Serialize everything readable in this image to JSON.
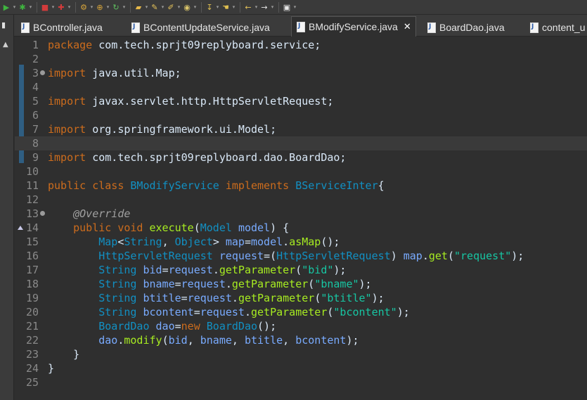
{
  "toolbar": {
    "icons": [
      {
        "name": "run-icon",
        "glyph": "▶",
        "color": "#3fb43f"
      },
      {
        "name": "debug-icon",
        "glyph": "✱",
        "color": "#3fb43f"
      },
      {
        "name": "stop-icon",
        "glyph": "■",
        "color": "#d23b3b"
      },
      {
        "name": "server-icon",
        "glyph": "✚",
        "color": "#d23b3b"
      },
      {
        "name": "new-wizard-icon",
        "glyph": "⚙",
        "color": "#d9a63a"
      },
      {
        "name": "new-package-icon",
        "glyph": "⊕",
        "color": "#d9a63a"
      },
      {
        "name": "refresh-icon",
        "glyph": "↻",
        "color": "#5fbf5f"
      },
      {
        "name": "open-folder-icon",
        "glyph": "▰",
        "color": "#e6b84a"
      },
      {
        "name": "open-type-icon",
        "glyph": "✎",
        "color": "#e6c35a"
      },
      {
        "name": "brush-icon",
        "glyph": "✐",
        "color": "#e6c35a"
      },
      {
        "name": "search-icon",
        "glyph": "◉",
        "color": "#d9c46a"
      },
      {
        "name": "next-annotation-icon",
        "glyph": "↧",
        "color": "#e0c050"
      },
      {
        "name": "last-edit-icon",
        "glyph": "☚",
        "color": "#e0c050"
      },
      {
        "name": "back-icon",
        "glyph": "←",
        "color": "#e6c35a"
      },
      {
        "name": "forward-icon",
        "glyph": "→",
        "color": "#e6e6e6"
      },
      {
        "name": "perspective-icon",
        "glyph": "▣",
        "color": "#e6e6e6"
      }
    ]
  },
  "tabs": [
    {
      "name": "tab-bcontroller",
      "label": "BController.java",
      "active": false
    },
    {
      "name": "tab-bcontentupdateservice",
      "label": "BContentUpdateService.java",
      "active": false
    },
    {
      "name": "tab-bmodifyservice",
      "label": "BModifyService.java",
      "active": true,
      "close": "✕"
    },
    {
      "name": "tab-boarddao",
      "label": "BoardDao.java",
      "active": false
    },
    {
      "name": "tab-content",
      "label": "content_u",
      "active": false
    }
  ],
  "editor": {
    "lines": [
      {
        "n": "1",
        "tokens": [
          [
            "kw",
            "package"
          ],
          [
            "pl",
            " com.tech.sprjt09replyboard.service;"
          ]
        ]
      },
      {
        "n": "2",
        "tokens": []
      },
      {
        "n": "3",
        "fold": true,
        "tokens": [
          [
            "kw",
            "import"
          ],
          [
            "pl",
            " java.util.Map;"
          ]
        ]
      },
      {
        "n": "4",
        "tokens": []
      },
      {
        "n": "5",
        "tokens": [
          [
            "kw",
            "import"
          ],
          [
            "pl",
            " javax.servlet.http.HttpServletRequest;"
          ]
        ]
      },
      {
        "n": "6",
        "tokens": []
      },
      {
        "n": "7",
        "tokens": [
          [
            "kw",
            "import"
          ],
          [
            "pl",
            " org.springframework.ui.Model;"
          ]
        ]
      },
      {
        "n": "8",
        "highlight": true,
        "tokens": []
      },
      {
        "n": "9",
        "tokens": [
          [
            "kw",
            "import"
          ],
          [
            "pl",
            " com.tech.sprjt09replyboard.dao.BoardDao;"
          ]
        ]
      },
      {
        "n": "10",
        "tokens": []
      },
      {
        "n": "11",
        "tokens": [
          [
            "kw",
            "public"
          ],
          [
            "pl",
            " "
          ],
          [
            "kw",
            "class"
          ],
          [
            "pl",
            " "
          ],
          [
            "ty",
            "BModifyService"
          ],
          [
            "pl",
            " "
          ],
          [
            "kw",
            "implements"
          ],
          [
            "pl",
            " "
          ],
          [
            "ty",
            "BServiceInter"
          ],
          [
            "pl",
            "{"
          ]
        ]
      },
      {
        "n": "12",
        "tokens": []
      },
      {
        "n": "13",
        "fold": true,
        "tokens": [
          [
            "pl",
            "    "
          ],
          [
            "an",
            "@Override"
          ]
        ]
      },
      {
        "n": "14",
        "override": true,
        "tokens": [
          [
            "pl",
            "    "
          ],
          [
            "kw",
            "public"
          ],
          [
            "pl",
            " "
          ],
          [
            "kw",
            "void"
          ],
          [
            "pl",
            " "
          ],
          [
            "me",
            "execute"
          ],
          [
            "pl",
            "("
          ],
          [
            "ty",
            "Model"
          ],
          [
            "pl",
            " "
          ],
          [
            "va",
            "model"
          ],
          [
            "pl",
            ") {"
          ]
        ]
      },
      {
        "n": "15",
        "tokens": [
          [
            "pl",
            "        "
          ],
          [
            "ty",
            "Map"
          ],
          [
            "pl",
            "<"
          ],
          [
            "ty",
            "String"
          ],
          [
            "pl",
            ", "
          ],
          [
            "ty",
            "Object"
          ],
          [
            "pl",
            "> "
          ],
          [
            "va",
            "map"
          ],
          [
            "pl",
            "="
          ],
          [
            "va",
            "model"
          ],
          [
            "pl",
            "."
          ],
          [
            "me",
            "asMap"
          ],
          [
            "pl",
            "();"
          ]
        ]
      },
      {
        "n": "16",
        "tokens": [
          [
            "pl",
            "        "
          ],
          [
            "ty",
            "HttpServletRequest"
          ],
          [
            "pl",
            " "
          ],
          [
            "va",
            "request"
          ],
          [
            "pl",
            "=("
          ],
          [
            "ty",
            "HttpServletRequest"
          ],
          [
            "pl",
            ") "
          ],
          [
            "va",
            "map"
          ],
          [
            "pl",
            "."
          ],
          [
            "me",
            "get"
          ],
          [
            "pl",
            "("
          ],
          [
            "st",
            "\"request\""
          ],
          [
            "pl",
            ");"
          ]
        ]
      },
      {
        "n": "17",
        "tokens": [
          [
            "pl",
            "        "
          ],
          [
            "ty",
            "String"
          ],
          [
            "pl",
            " "
          ],
          [
            "va",
            "bid"
          ],
          [
            "pl",
            "="
          ],
          [
            "va",
            "request"
          ],
          [
            "pl",
            "."
          ],
          [
            "me",
            "getParameter"
          ],
          [
            "pl",
            "("
          ],
          [
            "st",
            "\"bid\""
          ],
          [
            "pl",
            ");"
          ]
        ]
      },
      {
        "n": "18",
        "tokens": [
          [
            "pl",
            "        "
          ],
          [
            "ty",
            "String"
          ],
          [
            "pl",
            " "
          ],
          [
            "va",
            "bname"
          ],
          [
            "pl",
            "="
          ],
          [
            "va",
            "request"
          ],
          [
            "pl",
            "."
          ],
          [
            "me",
            "getParameter"
          ],
          [
            "pl",
            "("
          ],
          [
            "st",
            "\"bname\""
          ],
          [
            "pl",
            ");"
          ]
        ]
      },
      {
        "n": "19",
        "tokens": [
          [
            "pl",
            "        "
          ],
          [
            "ty",
            "String"
          ],
          [
            "pl",
            " "
          ],
          [
            "va",
            "btitle"
          ],
          [
            "pl",
            "="
          ],
          [
            "va",
            "request"
          ],
          [
            "pl",
            "."
          ],
          [
            "me",
            "getParameter"
          ],
          [
            "pl",
            "("
          ],
          [
            "st",
            "\"btitle\""
          ],
          [
            "pl",
            ");"
          ]
        ]
      },
      {
        "n": "20",
        "tokens": [
          [
            "pl",
            "        "
          ],
          [
            "ty",
            "String"
          ],
          [
            "pl",
            " "
          ],
          [
            "va",
            "bcontent"
          ],
          [
            "pl",
            "="
          ],
          [
            "va",
            "request"
          ],
          [
            "pl",
            "."
          ],
          [
            "me",
            "getParameter"
          ],
          [
            "pl",
            "("
          ],
          [
            "st",
            "\"bcontent\""
          ],
          [
            "pl",
            ");"
          ]
        ]
      },
      {
        "n": "21",
        "tokens": [
          [
            "pl",
            "        "
          ],
          [
            "ty",
            "BoardDao"
          ],
          [
            "pl",
            " "
          ],
          [
            "va",
            "dao"
          ],
          [
            "pl",
            "="
          ],
          [
            "kw",
            "new"
          ],
          [
            "pl",
            " "
          ],
          [
            "ty",
            "BoardDao"
          ],
          [
            "pl",
            "();"
          ]
        ]
      },
      {
        "n": "22",
        "tokens": [
          [
            "pl",
            "        "
          ],
          [
            "va",
            "dao"
          ],
          [
            "pl",
            "."
          ],
          [
            "me",
            "modify"
          ],
          [
            "pl",
            "("
          ],
          [
            "va",
            "bid"
          ],
          [
            "pl",
            ", "
          ],
          [
            "va",
            "bname"
          ],
          [
            "pl",
            ", "
          ],
          [
            "va",
            "btitle"
          ],
          [
            "pl",
            ", "
          ],
          [
            "va",
            "bcontent"
          ],
          [
            "pl",
            ");"
          ]
        ]
      },
      {
        "n": "23",
        "tokens": [
          [
            "pl",
            "    }"
          ]
        ]
      },
      {
        "n": "24",
        "tokens": [
          [
            "pl",
            "}"
          ]
        ]
      },
      {
        "n": "25",
        "tokens": []
      }
    ]
  }
}
